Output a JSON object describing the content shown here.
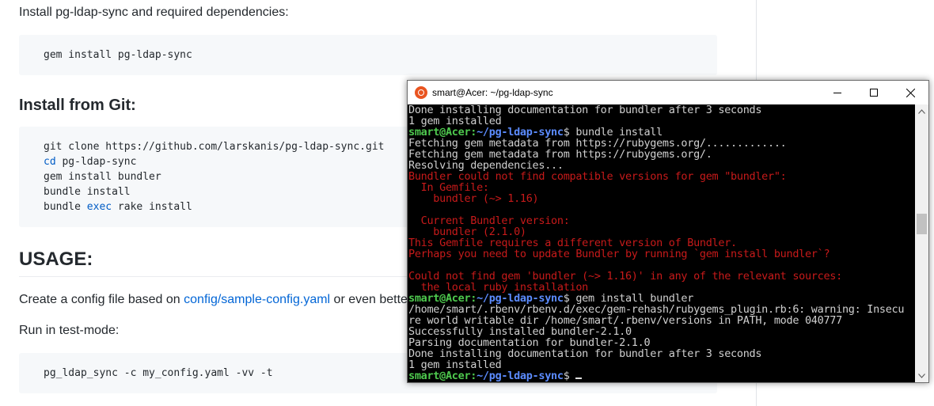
{
  "readme": {
    "intro_text": "Install pg-ldap-sync and required dependencies:",
    "gem_code": "gem install pg-ldap-sync",
    "install_git_heading": "Install from Git:",
    "git_lines": [
      {
        "pre": "git clone https://github.com/larskanis/pg-ldap-sync.git",
        "kw": "",
        "post": ""
      },
      {
        "pre": "",
        "kw": "cd",
        "post": " pg-ldap-sync"
      },
      {
        "pre": "gem install bundler",
        "kw": "",
        "post": ""
      },
      {
        "pre": "bundle install",
        "kw": "",
        "post": ""
      },
      {
        "pre": "bundle ",
        "kw": "exec",
        "post": " rake install"
      }
    ],
    "usage_heading": "USAGE:",
    "config_text_pre": "Create a config file based on ",
    "config_link": "config/sample-config.yaml",
    "config_text_post": " or even bette",
    "test_mode_text": "Run in test-mode:",
    "test_code": "pg_ldap_sync -c my_config.yaml -vv -t"
  },
  "terminal": {
    "title": "smart@Acer: ~/pg-ldap-sync",
    "prompt_user": "smart@Acer",
    "prompt_path": "~/pg-ldap-sync",
    "lines": [
      {
        "type": "out",
        "text": "Done installing documentation for bundler after 3 seconds"
      },
      {
        "type": "out",
        "text": "1 gem installed"
      },
      {
        "type": "prompt",
        "text": "$ bundle install"
      },
      {
        "type": "out",
        "text": "Fetching gem metadata from https://rubygems.org/............."
      },
      {
        "type": "out",
        "text": "Fetching gem metadata from https://rubygems.org/."
      },
      {
        "type": "out",
        "text": "Resolving dependencies..."
      },
      {
        "type": "err",
        "text": "Bundler could not find compatible versions for gem \"bundler\":"
      },
      {
        "type": "err",
        "text": "  In Gemfile:"
      },
      {
        "type": "err",
        "text": "    bundler (~> 1.16)"
      },
      {
        "type": "err",
        "text": ""
      },
      {
        "type": "err",
        "text": "  Current Bundler version:"
      },
      {
        "type": "err",
        "text": "    bundler (2.1.0)"
      },
      {
        "type": "err",
        "text": "This Gemfile requires a different version of Bundler."
      },
      {
        "type": "err",
        "text": "Perhaps you need to update Bundler by running `gem install bundler`?"
      },
      {
        "type": "err",
        "text": ""
      },
      {
        "type": "err",
        "text": "Could not find gem 'bundler (~> 1.16)' in any of the relevant sources:"
      },
      {
        "type": "err",
        "text": "  the local ruby installation"
      },
      {
        "type": "prompt",
        "text": "$ gem install bundler"
      },
      {
        "type": "out",
        "text": "/home/smart/.rbenv/rbenv.d/exec/gem-rehash/rubygems_plugin.rb:6: warning: Insecu"
      },
      {
        "type": "out",
        "text": "re world writable dir /home/smart/.rbenv/versions in PATH, mode 040777"
      },
      {
        "type": "out",
        "text": "Successfully installed bundler-2.1.0"
      },
      {
        "type": "out",
        "text": "Parsing documentation for bundler-2.1.0"
      },
      {
        "type": "out",
        "text": "Done installing documentation for bundler after 3 seconds"
      },
      {
        "type": "out",
        "text": "1 gem installed"
      },
      {
        "type": "cursor",
        "text": "$ "
      }
    ]
  }
}
